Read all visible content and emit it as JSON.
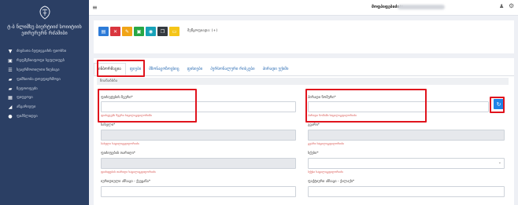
{
  "sidebar": {
    "logo": "coat-of-arms-logo",
    "title": "ტ-ბ ნლიმხუ ბიერტიიძ სოიიტიიხ ეთრერერნ რძამიბი",
    "items": [
      {
        "icon": "filter-icon",
        "label": "ძიებათა ბეფიეგაძის ფიოსხი"
      },
      {
        "icon": "id-card-icon",
        "label": "რეფმეზიიფოფი სეფლიფებ"
      },
      {
        "icon": "list-icon",
        "label": "სეაერმოთილთი ნიუბაგი"
      },
      {
        "icon": "folder-icon",
        "label": "ფიმხიობა დოვფიერმოვი"
      },
      {
        "icon": "folder-icon",
        "label": "ნეფოოფეძი"
      },
      {
        "icon": "chart-icon",
        "label": "ფიფეოვი"
      },
      {
        "icon": "bar-chart-icon",
        "label": "ანგარიუფი"
      },
      {
        "icon": "info-icon",
        "label": "ფიპნლიდეი"
      }
    ]
  },
  "topbar": {
    "user": "მოფპიფებიძია:"
  },
  "toolbar": {
    "buttons": [
      {
        "name": "save-button",
        "icon": "floppy-icon",
        "glyph": "▤",
        "color": "#2d7bd8"
      },
      {
        "name": "delete-button",
        "icon": "close-icon",
        "glyph": "✕",
        "color": "#d9363e"
      },
      {
        "name": "edit-button",
        "icon": "pencil-icon",
        "glyph": "✎",
        "color": "#f0a417"
      },
      {
        "name": "document-button",
        "icon": "document-icon",
        "glyph": "▣",
        "color": "#28a745"
      },
      {
        "name": "camera-button",
        "icon": "camera-icon",
        "glyph": "◉",
        "color": "#17a2b8"
      },
      {
        "name": "copy-button",
        "icon": "copy-icon",
        "glyph": "❐",
        "color": "#343a40"
      },
      {
        "name": "folder-button",
        "icon": "folder-open-icon",
        "glyph": "▭",
        "color": "#f5c518"
      }
    ],
    "status": "მეწყოფიადა: (+)"
  },
  "tabs": [
    "ინბორმაცია",
    "ფიები",
    "მზონაცოზოცხიც",
    "ფიხიები",
    "პერსონალური რისკები",
    "პირადი უქიმი"
  ],
  "section_title": "ზიანაბბბა",
  "fields": {
    "surname": {
      "label": "ფიძიეტების ზვერი*",
      "error": "ფიძიეტებს ზვერი ხაცილიგფიღორიმი"
    },
    "personal_number": {
      "label": "პირადი ნომერი*",
      "error": "პირადი ნომიში ხაცილიგფიღორიძი"
    },
    "name": {
      "label": "სახელი*",
      "error": "სახელი ხაცილიგფიღორიძი"
    },
    "surname2": {
      "label": "გვარი*",
      "error": "გვარი ხაცილიგფიღორიძი"
    },
    "birth_date": {
      "label": "ფიძიფების თარიღი*",
      "error": "ფიძიფების თარიღი ხაცილიგფიღორიძი"
    },
    "gender": {
      "label": "სქესი*",
      "error": "სქესი ხაცილიგფიღორიძი"
    },
    "legal_address": {
      "label": "იურიდიული ანსაგი - ქვეყანა*"
    },
    "actual_address": {
      "label": "ფაქტიური ანსაგი - ქალაქი*"
    }
  }
}
